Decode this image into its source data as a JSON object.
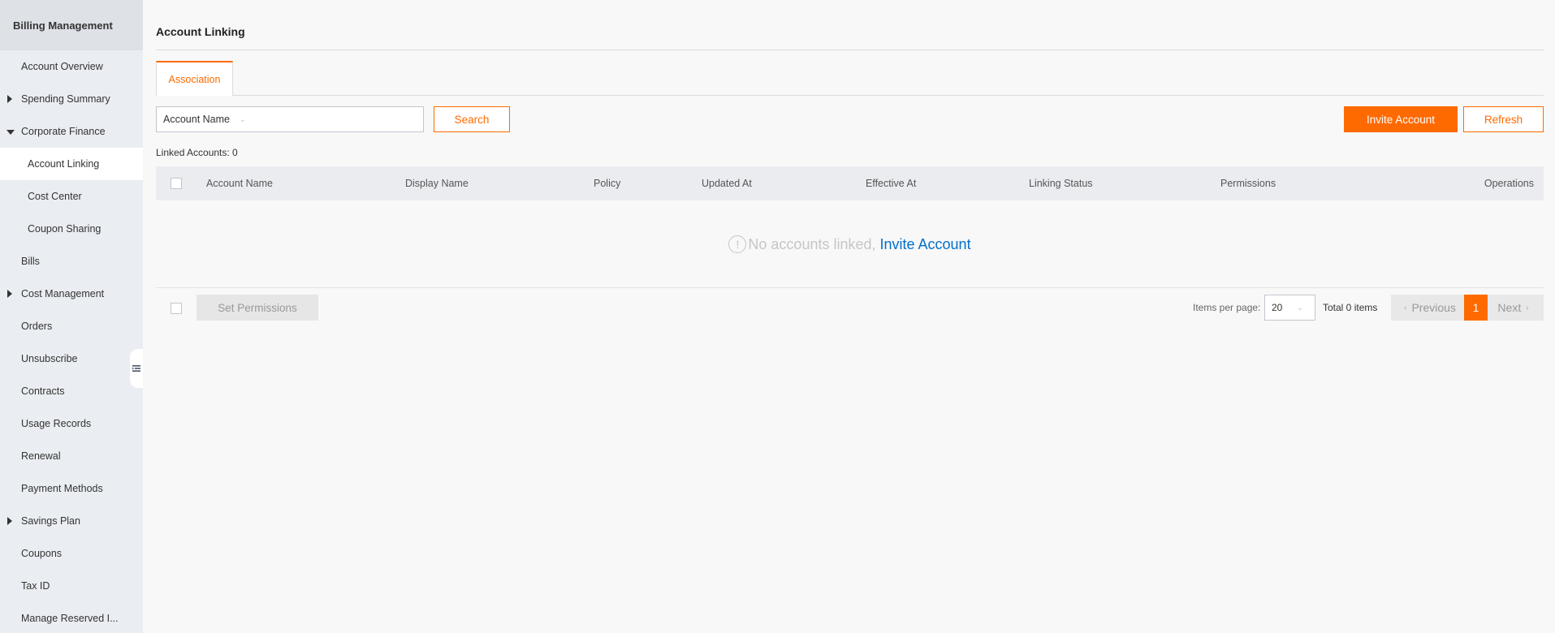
{
  "sidebar": {
    "title": "Billing Management",
    "items": [
      {
        "label": "Account Overview"
      },
      {
        "label": "Spending Summary"
      },
      {
        "label": "Corporate Finance"
      },
      {
        "label": "Account Linking"
      },
      {
        "label": "Cost Center"
      },
      {
        "label": "Coupon Sharing"
      },
      {
        "label": "Bills"
      },
      {
        "label": "Cost Management"
      },
      {
        "label": "Orders"
      },
      {
        "label": "Unsubscribe"
      },
      {
        "label": "Contracts"
      },
      {
        "label": "Usage Records"
      },
      {
        "label": "Renewal"
      },
      {
        "label": "Payment Methods"
      },
      {
        "label": "Savings Plan"
      },
      {
        "label": "Coupons"
      },
      {
        "label": "Tax ID"
      },
      {
        "label": "Manage Reserved I..."
      }
    ]
  },
  "page": {
    "title": "Account Linking",
    "tab": "Association"
  },
  "toolbar": {
    "filter_select": "Account Name",
    "search_label": "Search",
    "invite_label": "Invite Account",
    "refresh_label": "Refresh"
  },
  "summary": {
    "linked_accounts": "Linked Accounts: 0"
  },
  "table": {
    "columns": [
      "Account Name",
      "Display Name",
      "Policy",
      "Updated At",
      "Effective At",
      "Linking Status",
      "Permissions",
      "Operations"
    ],
    "empty_text": "No accounts linked,",
    "empty_link": "Invite Account"
  },
  "footer": {
    "set_permissions_label": "Set Permissions",
    "items_per_page_label": "Items per page:",
    "items_per_page_value": "20",
    "total_label": "Total 0 items",
    "previous_label": "Previous",
    "current_page": "1",
    "next_label": "Next"
  },
  "colors": {
    "accent": "#ff6a00",
    "link": "#0070cc",
    "sidebar_bg": "#eaedf1"
  }
}
